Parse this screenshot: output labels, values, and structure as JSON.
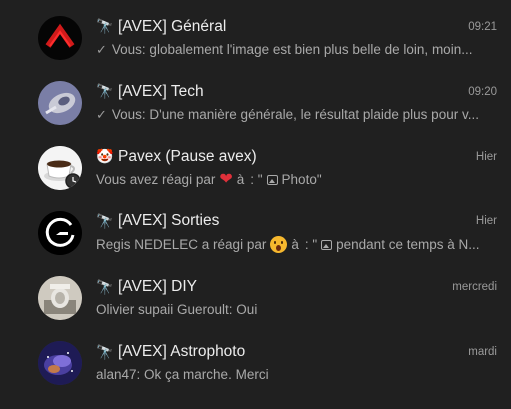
{
  "chats": [
    {
      "title": "[AVEX] Général",
      "title_icon": "telescope-icon",
      "time": "09:21",
      "preview": "Vous: globalement l'image est bien plus belle de loin, moin...",
      "read_check": true
    },
    {
      "title": "[AVEX] Tech",
      "title_icon": "telescope-icon",
      "time": "09:20",
      "preview": "Vous: D'une manière générale, le résultat plaide plus pour v...",
      "read_check": true
    },
    {
      "title": "Pavex (Pause avex)",
      "title_icon": "clown-icon",
      "time": "Hier",
      "preview_prefix": "Vous avez réagi par",
      "preview_reaction": "heart-emoji",
      "preview_mid": "à",
      "preview_quote_start": ": \"",
      "preview_suffix": "Photo\""
    },
    {
      "title": "[AVEX] Sorties",
      "title_icon": "telescope-icon",
      "time": "Hier",
      "preview_prefix": "Regis NEDELEC a réagi par",
      "preview_reaction": "astonished-emoji",
      "preview_mid": "à",
      "preview_quote_start": ": \"",
      "preview_suffix": "pendant ce temps à N..."
    },
    {
      "title": "[AVEX] DIY",
      "title_icon": "telescope-icon",
      "time": "mercredi",
      "preview": "Olivier supaii Gueroult: Oui"
    },
    {
      "title": "[AVEX] Astrophoto",
      "title_icon": "telescope-icon",
      "time": "mardi",
      "preview": "alan47: Ok ça marche. Merci"
    }
  ],
  "glyphs": {
    "telescope": "🔭",
    "clown": "🤡",
    "check": "✓",
    "heart": "❤"
  },
  "colors": {
    "background": "#202020",
    "heart": "#e0303a"
  }
}
